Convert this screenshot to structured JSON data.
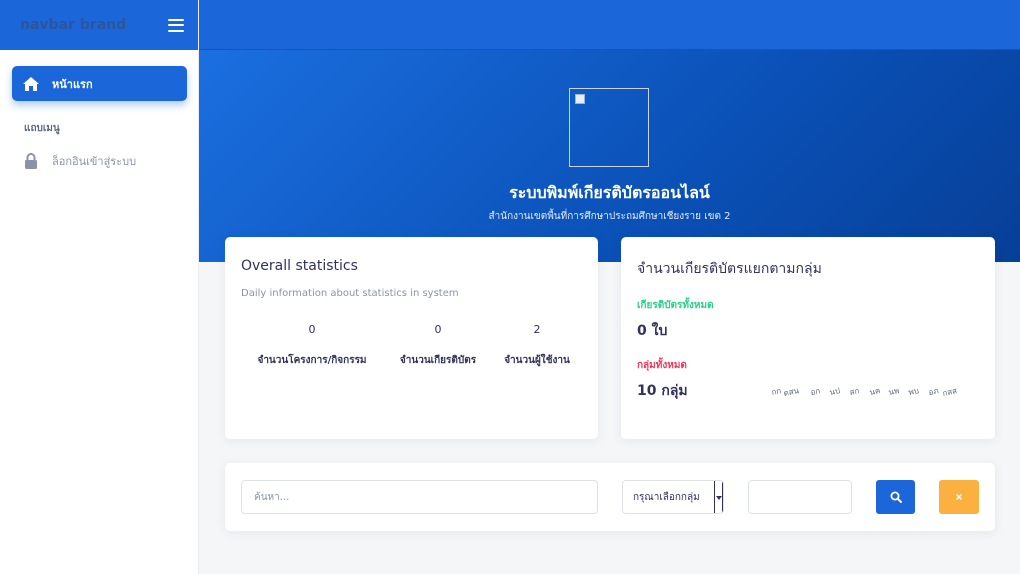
{
  "sidebar": {
    "brand": "navbar brand",
    "items": [
      {
        "label": "หน้าแรก",
        "icon": "home-icon",
        "active": true
      },
      {
        "label": "ล็อกอินเข้าสู่ระบบ",
        "icon": "lock-icon",
        "active": false
      }
    ],
    "heading": "แถบเมนู"
  },
  "hero": {
    "title": "ระบบพิมพ์เกียรติบัตรออนไลน์",
    "subtitle": "สำนักงานเขตพื้นที่การศึกษาประถมศึกษาเชียงราย เขต 2"
  },
  "stats_card": {
    "title": "Overall statistics",
    "subtitle": "Daily information about statistics in system",
    "stats": [
      {
        "value": "0",
        "label": "จำนวนโครงการ/กิจกรรม"
      },
      {
        "value": "0",
        "label": "จำนวนเกียรติบัตร"
      },
      {
        "value": "2",
        "label": "จำนวนผู้ใช้งาน"
      }
    ]
  },
  "groups_card": {
    "title": "จำนวนเกียรติบัตรแยกตามกลุ่ม",
    "total_certs_label": "เกียรติบัตรทั้งหมด",
    "total_certs_value": "0 ใบ",
    "total_groups_label": "กลุ่มทั้งหมด",
    "total_groups_value": "10 กลุ่ม",
    "group_labels": [
      "กก",
      "ตสน",
      "อก",
      "นป",
      "สก",
      "นค",
      "นพ",
      "พบ",
      "อภ",
      "กสส"
    ]
  },
  "filter": {
    "search_placeholder": "ค้นหา...",
    "select_value": "กรุณาเลือกกลุ่ม",
    "clear_label": "×"
  },
  "colors": {
    "primary": "#1b66d9",
    "success": "#2dce89",
    "danger": "#f5365c",
    "warning": "#fbb140"
  }
}
